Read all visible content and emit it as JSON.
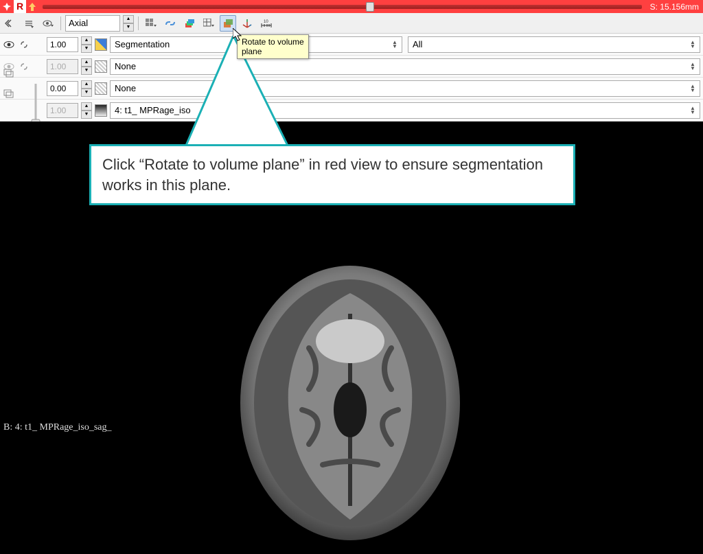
{
  "slice_slider": {
    "view_letter": "R",
    "value_label": "S: 15.156mm",
    "position_percent": 54
  },
  "toolbar": {
    "orientation_value": "Axial",
    "rotate_tooltip_line1": "Rotate to volume",
    "rotate_tooltip_line2": "plane"
  },
  "layers": {
    "label_row": {
      "opacity": "1.00",
      "selector_value": "Segmentation",
      "secondary_value": "All"
    },
    "fg_row": {
      "opacity": "1.00",
      "selector_value": "None"
    },
    "bg_row": {
      "opacity": "0.00",
      "selector_value": "None"
    },
    "vol_row": {
      "opacity": "1.00",
      "selector_value": "4: t1_ MPRage_iso"
    }
  },
  "viewer": {
    "overlay_label": "B: 4: t1_ MPRage_iso_sag_"
  },
  "callout": {
    "text": "Click “Rotate to volume plane” in red view to ensure segmentation works in this plane."
  }
}
